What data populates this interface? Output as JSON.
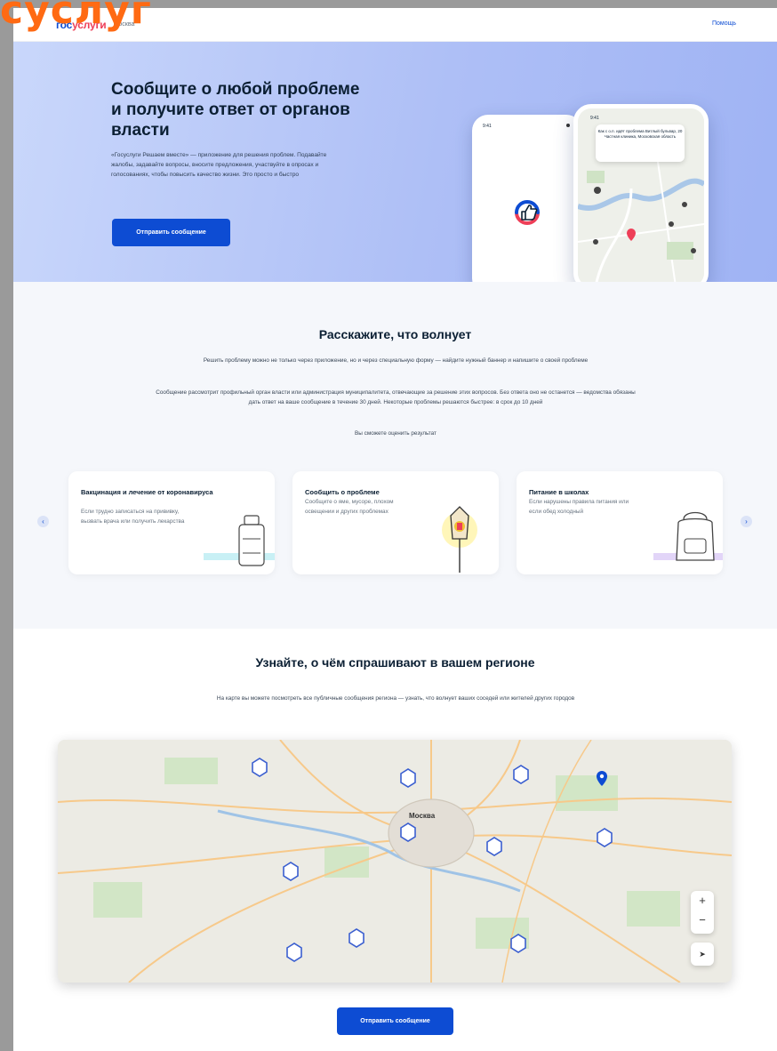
{
  "overlay": {
    "brand_text": "суслуг"
  },
  "header": {
    "logo_part1": "гос",
    "logo_part2": "услуги",
    "city": "Москва",
    "help": "Помощь"
  },
  "hero": {
    "title": "Сообщите о любой проблеме и получите ответ от органов власти",
    "text": "«Госуслуги Решаем вместе» — приложение для решения проблем. Подавайте жалобы, задавайте вопросы, вносите предложения, участвуйте в опросах и голосованиях, чтобы повысить качество жизни. Это просто и быстро",
    "button": "Отправить сообщение",
    "phone_time": "9:41",
    "phone_card": "Как с о.п. идёт проблема Витлый бульвар, 20 Частная клиника, Московская область"
  },
  "talk": {
    "title": "Расскажите, что волнует",
    "p1": "Решить проблему можно не только через приложение, но и через специальную форму — найдите нужный баннер и напишите о своей проблеме",
    "p2": "Сообщение рассмотрит профильный орган власти или администрация муниципалитета, отвечающие за решение этих вопросов. Без ответа оно не останется — ведомства обязаны дать ответ на ваше сообщение в течение 30 дней. Некоторые проблемы решаются быстрее: в срок до 10 дней",
    "p3": "Вы сможете оценить результат",
    "cards": [
      {
        "title": "Вакцинация и лечение от коронавируса",
        "text": "Если трудно записаться на прививку, вызвать врача или получить лекарства"
      },
      {
        "title": "Сообщить о проблеме",
        "text": "Сообщите о яме, мусоре, плохом освещении и других проблемах"
      },
      {
        "title": "Питание в школах",
        "text": "Если нарушены правила питания или если обед холодный"
      }
    ],
    "prev": "‹",
    "next": "›"
  },
  "region": {
    "title": "Узнайте, о чём спрашивают в вашем регионе",
    "text": "На карте вы можете посмотреть все публичные сообщения региона — узнать, что волнует ваших соседей или жителей других городов",
    "map_city": "Москва",
    "zoom_in": "+",
    "zoom_out": "−",
    "locate": "➤",
    "button": "Отправить сообщение"
  },
  "colors": {
    "accent": "#0d4cd3",
    "logo_red": "#ee3f58",
    "hero_bg": "#aebff6",
    "section_bg": "#f5f7fb",
    "overlay_orange": "#ff6a13"
  },
  "icons": [
    "thumbs-up-icon",
    "map-pin-icon",
    "cluster-marker-icon",
    "chevron-left-icon",
    "chevron-right-icon",
    "locate-icon"
  ]
}
